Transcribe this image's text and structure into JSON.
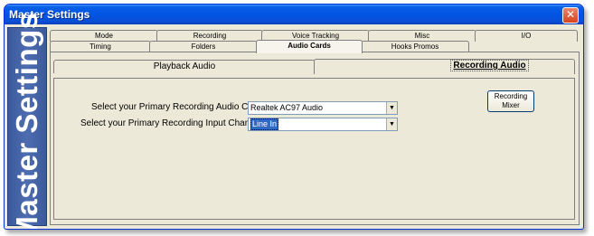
{
  "window": {
    "title": "Master Settings",
    "close_glyph": "✕"
  },
  "sidebar": {
    "text": "Master Settings"
  },
  "tabs_row1": [
    "Mode",
    "Recording",
    "Voice Tracking",
    "Misc",
    "I/O"
  ],
  "tabs_row2": [
    "Timing",
    "Folders",
    "Audio Cards",
    "Hooks Promos"
  ],
  "active_tab": "Audio Cards",
  "subtabs": {
    "playback": "Playback Audio",
    "recording": "Recording Audio",
    "active": "Recording Audio"
  },
  "form": {
    "card_label": "Select your Primary Recording Audio Card",
    "card_value": "Realtek AC97 Audio",
    "channel_label": "Select your Primary Recording Input Channel",
    "channel_value": "Line In"
  },
  "mixer_button": {
    "line1": "Recording",
    "line2": "Mixer"
  },
  "icons": {
    "dropdown": "chevron-down-icon",
    "close": "close-icon"
  }
}
